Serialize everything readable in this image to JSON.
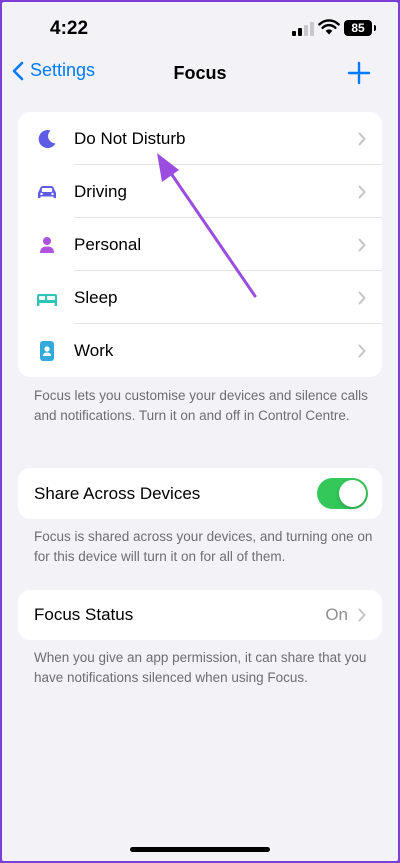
{
  "status_bar": {
    "time": "4:22",
    "battery": "85"
  },
  "nav": {
    "back_label": "Settings",
    "title": "Focus"
  },
  "focus_modes": [
    {
      "label": "Do Not Disturb",
      "icon": "moon-icon",
      "color": "#5e5ce6"
    },
    {
      "label": "Driving",
      "icon": "car-icon",
      "color": "#5e5ce6"
    },
    {
      "label": "Personal",
      "icon": "person-icon",
      "color": "#af52de"
    },
    {
      "label": "Sleep",
      "icon": "bed-icon",
      "color": "#30c4b5"
    },
    {
      "label": "Work",
      "icon": "id-badge-icon",
      "color": "#34aadc"
    }
  ],
  "focus_footnote": "Focus lets you customise your devices and silence calls and notifications. Turn it on and off in Control Centre.",
  "share": {
    "label": "Share Across Devices",
    "on": true
  },
  "share_footnote": "Focus is shared across your devices, and turning one on for this device will turn it on for all of them.",
  "status": {
    "label": "Focus Status",
    "value": "On"
  },
  "status_footnote": "When you give an app permission, it can share that you have notifications silenced when using Focus.",
  "colors": {
    "accent": "#007aff",
    "toggle_on": "#34c759",
    "annotation_arrow": "#9b4de0"
  }
}
